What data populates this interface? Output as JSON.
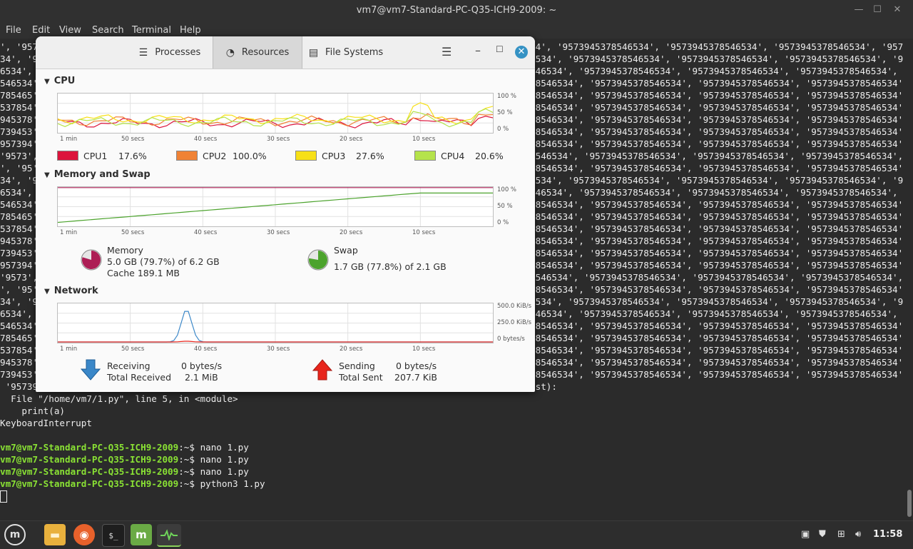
{
  "terminal": {
    "title": "vm7@vm7-Standard-PC-Q35-ICH9-2009: ~",
    "menu": [
      "File",
      "Edit",
      "View",
      "Search",
      "Terminal",
      "Help"
    ],
    "lines": [
      "', '9573945378546534', '9573945378546534', '9573945378546534', '9573945378546534', '9573945378546534', '9573945378546534', '9573945378546534', '9573945378546534', '9573945378546534', '95739453785465",
      "34', '9573945378546534', '9573945378546534', '9573945378546534', '9573945378546534', '9573945378546534', '9573945378546534', '9573945378546534', '9573945378546534', '9573945378546534', '957394537854",
      "6534', '9573945378546534', '9573945378546534', '9573945378546534', '9573945378546534', '9573945378546534', '9573945378546534', '9573945378546534', '9573945378546534', '9573945378546534', '9573945378",
      "546534', '9573945378546534', '9573945378546534', '9573945378546534', '9573945378546534', '9573945378546534', '9573945378546534', '9573945378546534', '9573945378546534', '9573945378546534', '95739453",
      "785465', '9573945378546534', '9573945378546534', '9573945378546534', '9573945378546534', '9573945378546534', '9573945378546534', '9573945378546534', '9573945378546534', '9573945378546534', '957394",
      "537854', '9573945378546534', '9573945378546534', '9573945378546534', '9573945378546534', '9573945378546534', '9573945378546534', '9573945378546534', '9573945378546534', '9573945378546534', '9573",
      "945378', '9573945378546534', '9573945378546534', '9573945378546534', '9573945378546534', '9573945378546534', '9573945378546534', '9573945378546534', '9573945378546534', '9573945378546534', '95",
      "739453', '9573945378546534', '9573945378546534', '9573945378546534', '9573945378546534', '9573945378546534', '9573945378546534', '9573945378546534', '9573945378546534', '9573945378546534', '",
      "957394', '9573945378546534', '9573945378546534', '9573945378546534', '9573945378546534', '9573945378546534', '9573945378546534', '9573945378546534', '9573945378546534', '9573945378546534',",
      "'9573', '9573945378546534', '9573945378546534', '9573945378546534', '9573945378546534', '9573945378546534', '9573945378546534', '9573945378546534', '9573945378546534', '9573945378546534', '9573945378546534",
      "', '95', '9573945378546534', '9573945378546534', '9573945378546534', '9573945378546534', '9573945378546534', '9573945378546534', '9573945378546534', '9573945378546534', '9573945378546534', '95739453785465",
      "34', '9573945378546534', '9573945378546534', '9573945378546534', '9573945378546534', '9573945378546534', '9573945378546534', '9573945378546534', '9573945378546534', '9573945378546534', '957394537854",
      "6534', '9573945378546534', '9573945378546534', '9573945378546534', '9573945378546534', '9573945378546534', '9573945378546534', '9573945378546534', '9573945378546534', '9573945378546534', '9573945378",
      "546534', '9573945378546534', '9573945378546534', '9573945378546534', '9573945378546534', '9573945378546534', '9573945378546534', '9573945378546534', '9573945378546534', '9573945378546534', '95739453",
      "785465', '9573945378546534', '9573945378546534', '9573945378546534', '9573945378546534', '9573945378546534', '9573945378546534', '9573945378546534', '9573945378546534', '9573945378546534', '957394",
      "537854', '9573945378546534', '9573945378546534', '9573945378546534', '9573945378546534', '9573945378546534', '9573945378546534', '9573945378546534', '9573945378546534', '9573945378546534', '9573",
      "945378', '9573945378546534', '9573945378546534', '9573945378546534', '9573945378546534', '9573945378546534', '9573945378546534', '9573945378546534', '9573945378546534', '9573945378546534', '95",
      "739453', '9573945378546534', '9573945378546534', '9573945378546534', '9573945378546534', '9573945378546534', '9573945378546534', '9573945378546534', '9573945378546534', '9573945378546534', '",
      "957394', '9573945378546534', '9573945378546534', '9573945378546534', '9573945378546534', '9573945378546534', '9573945378546534', '9573945378546534', '9573945378546534', '9573945378546534',",
      "'9573', '9573945378546534', '9573945378546534', '9573945378546534', '9573945378546534', '9573945378546534', '9573945378546534', '9573945378546534', '9573945378546534', '9573945378546534', '9573945378546534",
      "', '95', '9573945378546534', '9573945378546534', '9573945378546534', '9573945378546534', '9573945378546534', '9573945378546534', '9573945378546534', '9573945378546534', '9573945378546534', '95739453785465",
      "34', '9573945378546534', '9573945378546534', '9573945378546534', '9573945378546534', '9573945378546534', '9573945378546534', '9573945378546534', '9573945378546534', '9573945378546534', '957394537854",
      "6534', '9573945378546534', '9573945378546534', '9573945378546534', '9573945378546534', '9573945378546534', '9573945378546534', '9573945378546534', '9573945378546534', '9573945378546534', '9573945378",
      "546534', '9573945378546534', '9573945378546534', '9573945378546534', '9573945378546534', '9573945378546534', '9573945378546534', '9573945378546534', '9573945378546534', '9573945378546534', '95739453",
      "785465', '9573945378546534', '9573945378546534', '9573945378546534', '9573945378546534', '9573945378546534', '9573945378546534', '9573945378546534', '9573945378546534', '9573945378546534', '957394",
      "537854', '9573945378546534', '9573945378546534', '9573945378546534', '9573945378546534', '9573945378546534', '9573945378546534', '9573945378546534', '9573945378546534', '9573945378546534', '9573",
      "945378', '9573945378546534', '9573945378546534', '9573945378546534', '9573945378546534', '9573945378546534', '9573945378546534', '9573945378546534', '9573945378546534', '9573945378546534', '95",
      "739453', '9573945378546534', '9573945378546534', '9573945378546534', '9573945378546534', '9573945378546534', '9573945378546534', '9573945378546534', '9573945378546534', '9573945378546534', '",
      " '9573945378546534', '9573945378546534', '9573945378546534', '95739^CTraceback (most recent call last):",
      "  File \"/home/vm7/1.py\", line 5, in <module>",
      "    print(a)",
      "KeyboardInterrupt",
      ""
    ],
    "prompt": "vm7@vm7-Standard-PC-Q35-ICH9-2009",
    "prompt_suffix": ":~$ ",
    "commands": [
      "nano 1.py",
      "nano 1.py",
      "nano 1.py",
      "python3 1.py"
    ]
  },
  "sysmon": {
    "tabs": [
      {
        "label": "Processes",
        "icon": "list-icon"
      },
      {
        "label": "Resources",
        "icon": "gauge-icon"
      },
      {
        "label": "File Systems",
        "icon": "disk-icon"
      }
    ],
    "active_tab": "Resources",
    "cpu": {
      "title": "CPU",
      "ylabels": [
        "100 %",
        "50 %",
        "0 %"
      ],
      "xlabels": [
        "1 min",
        "50 secs",
        "40 secs",
        "30 secs",
        "20 secs",
        "10 secs"
      ],
      "cores": [
        {
          "name": "CPU1",
          "value": "17.6%",
          "color": "#dc143c"
        },
        {
          "name": "CPU2",
          "value": "100.0%",
          "color": "#f08235"
        },
        {
          "name": "CPU3",
          "value": "27.6%",
          "color": "#f7e017"
        },
        {
          "name": "CPU4",
          "value": "20.6%",
          "color": "#b5e34b"
        }
      ]
    },
    "memory": {
      "title": "Memory and Swap",
      "ylabels": [
        "100 %",
        "50 %",
        "0 %"
      ],
      "xlabels": [
        "1 min",
        "50 secs",
        "40 secs",
        "30 secs",
        "20 secs",
        "10 secs"
      ],
      "mem_label": "Memory",
      "mem_value": "5.0 GB (79.7%) of 6.2 GB",
      "mem_cache": "Cache 189.1 MB",
      "mem_fraction": 0.797,
      "swap_label": "Swap",
      "swap_value": "1.7 GB (77.8%) of 2.1 GB",
      "swap_fraction": 0.778,
      "mem_color": "#ad1e55",
      "swap_color": "#4ca32d"
    },
    "network": {
      "title": "Network",
      "ylabels": [
        "500.0 KiB/s",
        "250.0 KiB/s",
        "0 bytes/s"
      ],
      "xlabels": [
        "1 min",
        "50 secs",
        "40 secs",
        "30 secs",
        "20 secs",
        "10 secs"
      ],
      "receiving_label": "Receiving",
      "receiving_value": "0 bytes/s",
      "total_received_label": "Total Received",
      "total_received_value": "2.1 MiB",
      "sending_label": "Sending",
      "sending_value": "0 bytes/s",
      "total_sent_label": "Total Sent",
      "total_sent_value": "207.7 KiB"
    }
  },
  "taskbar": {
    "clock": "11:58"
  }
}
